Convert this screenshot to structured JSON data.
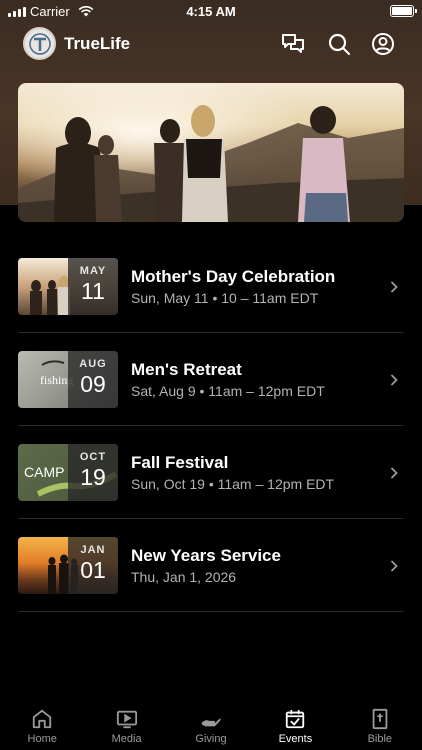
{
  "status_bar": {
    "carrier": "Carrier",
    "time": "4:15 AM"
  },
  "header": {
    "title": "TrueLife",
    "icons": [
      "chat-icon",
      "search-icon",
      "account-icon"
    ]
  },
  "events": [
    {
      "month": "MAY",
      "day": "11",
      "title": "Mother's Day Celebration",
      "subtitle": "Sun, May 11 • 10 – 11am EDT"
    },
    {
      "month": "AUG",
      "day": "09",
      "title": "Men's Retreat",
      "subtitle": "Sat, Aug 9 • 11am – 12pm EDT",
      "thumb_text": "fishing"
    },
    {
      "month": "OCT",
      "day": "19",
      "title": "Fall Festival",
      "subtitle": "Sun, Oct 19 • 11am – 12pm EDT",
      "thumb_text": "CAMP"
    },
    {
      "month": "JAN",
      "day": "01",
      "title": "New Years Service",
      "subtitle": "Thu, Jan 1, 2026"
    }
  ],
  "tabs": [
    {
      "label": "Home",
      "icon": "home-icon",
      "active": false
    },
    {
      "label": "Media",
      "icon": "media-icon",
      "active": false
    },
    {
      "label": "Giving",
      "icon": "giving-icon",
      "active": false
    },
    {
      "label": "Events",
      "icon": "calendar-icon",
      "active": true
    },
    {
      "label": "Bible",
      "icon": "bible-icon",
      "active": false
    }
  ],
  "colors": {
    "background": "#000000",
    "header_gradient": "#4a3526",
    "secondary_text": "#b3b3b3",
    "tab_inactive": "#9a9a9a"
  }
}
